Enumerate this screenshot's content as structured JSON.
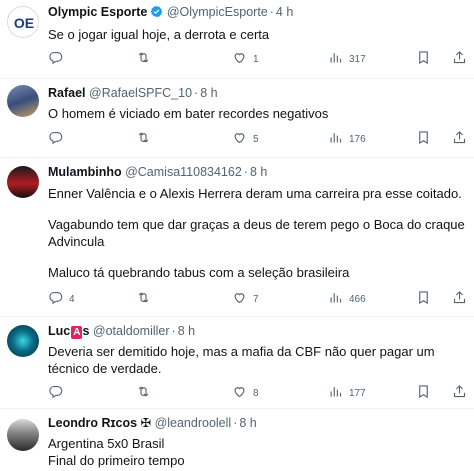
{
  "tweets": [
    {
      "name": "Olympic Esporte",
      "handle": "@OlympicEsporte",
      "time": "4 h",
      "verified": true,
      "lines": [
        "Se o jogar igual hoje, a derrota e certa"
      ],
      "replies": "",
      "retweets": "",
      "likes": "1",
      "views": "317"
    },
    {
      "name": "Rafael",
      "handle": "@RafaelSPFC_10",
      "time": "8 h",
      "lines": [
        "O homem é viciado em bater recordes negativos"
      ],
      "replies": "",
      "retweets": "",
      "likes": "5",
      "views": "176"
    },
    {
      "name": "Mulambinho",
      "handle": "@Camisa110834162",
      "time": "8 h",
      "lines": [
        "Enner Valência e o Alexis Herrera deram uma carreira pra esse coitado.",
        "",
        "Vagabundo tem que dar graças a deus de terem pego o Boca do craque Advincula",
        "",
        "Maluco tá quebrando tabus com a seleção brasileira"
      ],
      "replies": "4",
      "retweets": "",
      "likes": "7",
      "views": "466"
    },
    {
      "name": "Luc",
      "name_badge": "A",
      "name_suffix": "s",
      "handle": "@otaldomiller",
      "time": "8 h",
      "lines": [
        "Deveria ser demitido hoje, mas a mafia da CBF não quer pagar um técnico de verdade."
      ],
      "replies": "",
      "retweets": "",
      "likes": "8",
      "views": "177"
    },
    {
      "name": "Leondro Rɪcos",
      "name_symbol": "✠",
      "handle": "@leandroolell",
      "time": "8 h",
      "lines": [
        "Argentina 5x0 Brasil",
        "Final do primeiro tempo"
      ],
      "replies": "",
      "retweets": "",
      "likes": "",
      "views": ""
    }
  ],
  "colors": {
    "text": "#0f1419",
    "meta": "#536471",
    "verified": "#1d9bf0",
    "separator": "#eff3f4"
  },
  "icons": [
    "reply-icon",
    "retweet-icon",
    "heart-icon",
    "views-icon",
    "bookmark-icon",
    "share-icon",
    "verified-icon"
  ]
}
